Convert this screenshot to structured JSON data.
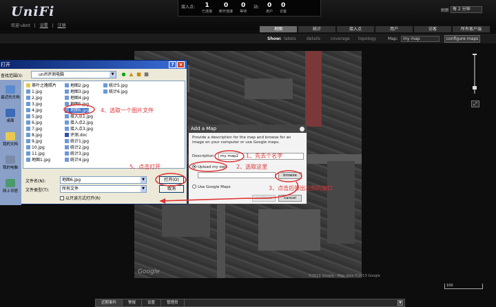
{
  "header": {
    "logo": "UniFi",
    "welcome": "欢迎 ubnt",
    "settings_link": "设置",
    "logout_link": "注销",
    "stats_label": "接入点:",
    "stats": [
      {
        "value": "1",
        "label": "已连接"
      },
      {
        "value": "0",
        "label": "断开连接"
      },
      {
        "value": "0",
        "label": "等待"
      },
      {
        "value": "0",
        "label": "用户"
      },
      {
        "value": "0",
        "label": "访客"
      }
    ],
    "station_label": "站:",
    "refresh_label": "刷新",
    "refresh_value": "每 2 分钟"
  },
  "tabs": [
    "地图",
    "统计",
    "接入点",
    "用户",
    "访客",
    "所有客户端"
  ],
  "toolbar": {
    "show_label": "Show:",
    "options": [
      "labels",
      "details",
      "coverage",
      "topology"
    ],
    "map_label": "Map:",
    "map_value": "my map",
    "configure_label": "configure maps"
  },
  "map": {
    "google_mark": "Google",
    "copyright": "©2013 Google - Map data ©2013 Google",
    "scale": "100"
  },
  "footer": {
    "tabs": [
      "近期事件",
      "警报",
      "设置",
      "管理员"
    ]
  },
  "open_dialog": {
    "title": "打开",
    "lookin_label": "查找范围(I):",
    "lookin_value": "unifi评测电脑",
    "places": [
      "最近的文档",
      "桌面",
      "我的文档",
      "我的电脑",
      "网上邻居"
    ],
    "files": [
      {
        "name": "茶叶之路照片",
        "folder": true
      },
      {
        "name": "1.jpg"
      },
      {
        "name": "2.jpg"
      },
      {
        "name": "3.jpg"
      },
      {
        "name": "4.jpg"
      },
      {
        "name": "5.jpg"
      },
      {
        "name": "6.jpg"
      },
      {
        "name": "7.jpg"
      },
      {
        "name": "8.jpg"
      },
      {
        "name": "9.jpg"
      },
      {
        "name": "10.jpg"
      },
      {
        "name": "11.jpg"
      },
      {
        "name": "地图1.jpg"
      },
      {
        "name": "地图2.jpg"
      },
      {
        "name": "地图3.jpg"
      },
      {
        "name": "地图4.jpg"
      },
      {
        "name": "地图5.jpg"
      },
      {
        "name": "地图6.jpg",
        "selected": true
      },
      {
        "name": "接入点1.jpg"
      },
      {
        "name": "接入点2.jpg"
      },
      {
        "name": "接入点3.jpg"
      },
      {
        "name": "评测.doc"
      },
      {
        "name": "统计1.jpg"
      },
      {
        "name": "统计2.jpg"
      },
      {
        "name": "统计3.jpg"
      },
      {
        "name": "统计4.jpg"
      },
      {
        "name": "统计5.jpg"
      },
      {
        "name": "统计6.jpg"
      }
    ],
    "filename_label": "文件名(N):",
    "filename_value": "地图6.jpg",
    "filetype_label": "文件类型(T):",
    "filetype_value": "所有文件",
    "readonly_label": "以只读方式打开(R)",
    "open_label": "打开(O)",
    "cancel_label": "取消"
  },
  "add_map": {
    "title": "Add a Map",
    "description": "Provide a description for the map and browse for an image on your computer or use Google maps.",
    "desc_label": "Description",
    "desc_value": "my map2",
    "upload_label": "Upload my own",
    "browse_label": "browse",
    "google_label": "Use Google Maps",
    "continue_label": "continue",
    "cancel_label": "cancel"
  },
  "notes": {
    "n1": "1、先去个名字",
    "n2": "2、选取这里",
    "n3": "3、点击后弹出左侧的窗口",
    "n4": "4、选取一个图片文件",
    "n5": "5、点击打开"
  },
  "colors": {
    "annotation": "#e03030",
    "selection": "#316ac5",
    "titlebar": "#0a246a"
  }
}
